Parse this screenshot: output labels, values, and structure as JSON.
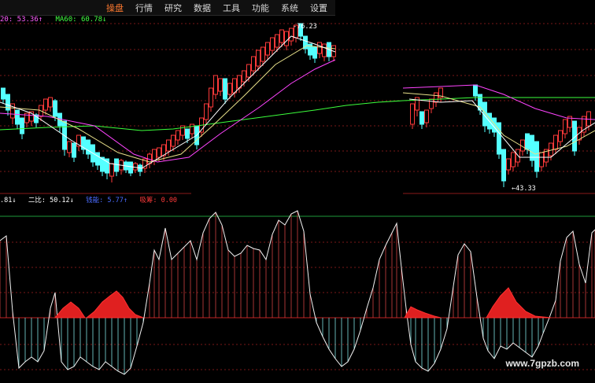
{
  "menu": {
    "items": [
      "操盘",
      "行情",
      "研究",
      "数据",
      "工具",
      "功能",
      "系统",
      "设置"
    ],
    "active": "操盘"
  },
  "ma_legend": {
    "ma20_text": "20: 53.36↑",
    "ma60_text": "MA60: 60.78↓",
    "colors": {
      "ma20": "#ff44ff",
      "ma60": "#44ff44",
      "ma5": "#ffffff",
      "ma10": "#ffff66"
    }
  },
  "indicator_legend": {
    "item1": ".81↓",
    "item2": "二比: 50.12↓",
    "item3": "钱能: 5.77↑",
    "item4": "吸筹: 0.00"
  },
  "chart_data": {
    "type": "candlestick",
    "panes": [
      "price",
      "indicator"
    ],
    "annotations": {
      "high": "-76.23",
      "low": "43.33"
    },
    "colors": {
      "up": "#ff3a3a",
      "down": "#54ffff",
      "ma5": "#ffffff",
      "ma10": "#e8e08a",
      "ma20": "#ff44ff",
      "ma60": "#3cff3c"
    }
  },
  "watermark": "www.7gpzb.com"
}
